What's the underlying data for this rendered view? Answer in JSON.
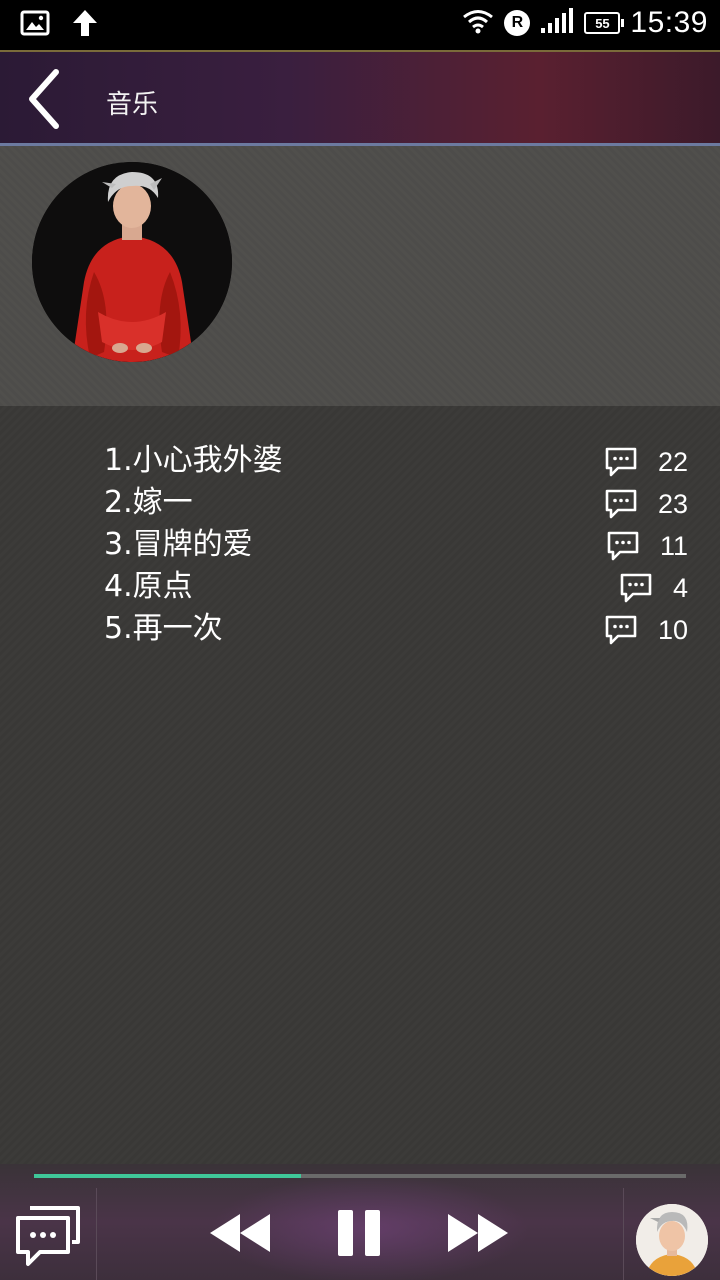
{
  "status_bar": {
    "time": "15:39",
    "battery": "55",
    "carrier_badge": "R"
  },
  "header": {
    "title": "音乐"
  },
  "songs": [
    {
      "name": "1.小心我外婆",
      "comments": "22"
    },
    {
      "name": "2.嫁一",
      "comments": "23"
    },
    {
      "name": "3.冒牌的爱",
      "comments": "11"
    },
    {
      "name": "4.原点",
      "comments": "4"
    },
    {
      "name": "5.再一次",
      "comments": "10"
    }
  ],
  "player": {
    "progress": 0.41
  },
  "colors": {
    "accent": "#3fc799"
  },
  "icons": [
    "image-notification-icon",
    "upload-arrow-icon",
    "wifi-icon",
    "signal-icon",
    "battery-icon",
    "back-chevron-icon",
    "comment-icon",
    "chat-icon",
    "rewind-icon",
    "pause-icon",
    "fast-forward-icon"
  ]
}
